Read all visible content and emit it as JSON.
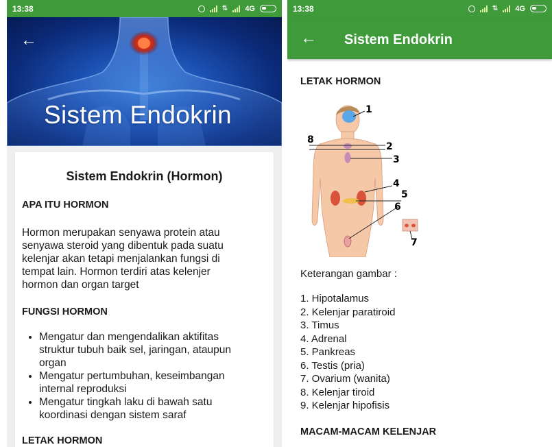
{
  "status_bar": {
    "time": "13:38",
    "network": "4G"
  },
  "left_screen": {
    "hero_title": "Sistem Endokrin",
    "article_title": "Sistem Endokrin (Hormon)",
    "section1_heading": "APA ITU HORMON",
    "section1_lines": [
      "Hormon merupakan senyawa protein atau",
      "senyawa steroid yang dibentuk pada suatu",
      "kelenjar akan tetapi menjalankan fungsi di",
      "tempat lain. Hormon terdiri atas kelenjer",
      "hormon dan organ target"
    ],
    "section2_heading": "FUNGSI HORMON",
    "bullets": [
      [
        "Mengatur dan mengendalikan aktifitas",
        "struktur tubuh baik sel, jaringan, ataupun",
        "organ"
      ],
      [
        "Mengatur pertumbuhan, keseimbangan",
        "internal reproduksi"
      ],
      [
        "Mengatur tingkah laku di bawah satu",
        "koordinasi dengan sistem saraf"
      ]
    ],
    "cut_off_heading": "LETAK HORMON"
  },
  "right_screen": {
    "appbar_title": "Sistem Endokrin",
    "section_heading": "LETAK HORMON",
    "diagram_numbers": [
      "1",
      "2",
      "3",
      "4",
      "5",
      "6",
      "7",
      "8"
    ],
    "keterangan_label": "Keterangan gambar :",
    "legend": [
      "1. Hipotalamus",
      "2. Kelenjar paratiroid",
      "3. Timus",
      "4. Adrenal",
      "5. Pankreas",
      "6. Testis (pria)",
      "7. Ovarium (wanita)",
      "8. Kelenjar tiroid",
      "9. Kelenjar hipofisis"
    ],
    "next_heading": "MACAM-MACAM KELENJAR"
  },
  "colors": {
    "primary_green": "#3f9a3a",
    "hero_blue": "#1a4fb0"
  }
}
